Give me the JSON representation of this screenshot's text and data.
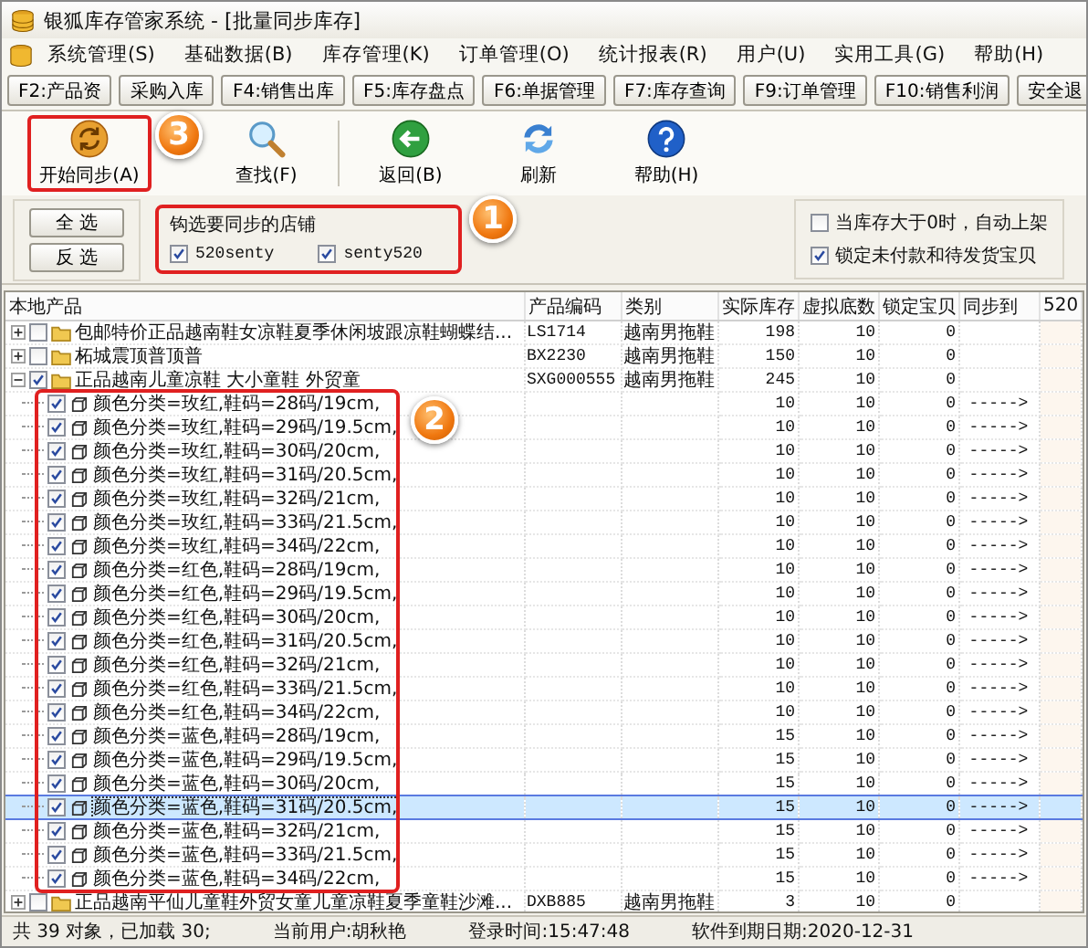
{
  "window": {
    "title": "银狐库存管家系统 - [批量同步库存]"
  },
  "menu": [
    "系统管理(S)",
    "基础数据(B)",
    "库存管理(K)",
    "订单管理(O)",
    "统计报表(R)",
    "用户(U)",
    "实用工具(G)",
    "帮助(H)"
  ],
  "function_keys": [
    "F2:产品资",
    "采购入库",
    "F4:销售出库",
    "F5:库存盘点",
    "F6:单据管理",
    "F7:库存查询",
    "F9:订单管理",
    "F10:销售利润",
    "安全退"
  ],
  "toolbar": [
    {
      "kind": "sync",
      "label": "开始同步(A)",
      "highlighted": true,
      "callout": "3"
    },
    {
      "kind": "search",
      "label": "查找(F)",
      "highlighted": false
    },
    {
      "kind": "separator"
    },
    {
      "kind": "back",
      "label": "返回(B)",
      "highlighted": false
    },
    {
      "kind": "refresh",
      "label": "刷新",
      "highlighted": false
    },
    {
      "kind": "help",
      "label": "帮助(H)",
      "highlighted": false
    }
  ],
  "selection_buttons": [
    "全 选",
    "反 选"
  ],
  "store_group": {
    "title": "钩选要同步的店铺",
    "highlighted": true,
    "callout": "1",
    "stores": [
      {
        "name": "520senty",
        "checked": true
      },
      {
        "name": "senty520",
        "checked": true
      }
    ]
  },
  "settings": [
    {
      "label": "当库存大于0时，自动上架",
      "checked": false
    },
    {
      "label": "锁定未付款和待发货宝贝",
      "checked": true
    }
  ],
  "table": {
    "columns": [
      "本地产品",
      "产品编码",
      "类别",
      "实际库存",
      "虚拟底数",
      "锁定宝贝",
      "同步到",
      "520"
    ],
    "rows": [
      {
        "label": "包邮特价正品越南鞋女凉鞋夏季休闲坡跟凉鞋蝴蝶结...",
        "code": "LS1714",
        "category": "越南男拖鞋",
        "stock": "198",
        "virtual": "10",
        "locked": "0",
        "checked": false,
        "expanded": false,
        "selected": false
      },
      {
        "label": "柘城震顶普顶普",
        "code": "BX2230",
        "category": "越南男拖鞋",
        "stock": "150",
        "virtual": "10",
        "locked": "0",
        "checked": false,
        "expanded": false,
        "selected": false
      },
      {
        "label": "正品越南儿童凉鞋 大小童鞋 外贸童",
        "code": "SXG000555",
        "category": "越南男拖鞋",
        "stock": "245",
        "virtual": "10",
        "locked": "0",
        "checked": true,
        "expanded": true,
        "selected": false,
        "callout": "2",
        "children_framed": true,
        "children": [
          {
            "label": "颜色分类=玫红,鞋码=28码/19cm,",
            "stock": "10",
            "virtual": "10",
            "locked": "0",
            "sync": "----->",
            "checked": true,
            "selected": false
          },
          {
            "label": "颜色分类=玫红,鞋码=29码/19.5cm,",
            "stock": "10",
            "virtual": "10",
            "locked": "0",
            "sync": "----->",
            "checked": true,
            "selected": false
          },
          {
            "label": "颜色分类=玫红,鞋码=30码/20cm,",
            "stock": "10",
            "virtual": "10",
            "locked": "0",
            "sync": "----->",
            "checked": true,
            "selected": false
          },
          {
            "label": "颜色分类=玫红,鞋码=31码/20.5cm,",
            "stock": "10",
            "virtual": "10",
            "locked": "0",
            "sync": "----->",
            "checked": true,
            "selected": false
          },
          {
            "label": "颜色分类=玫红,鞋码=32码/21cm,",
            "stock": "10",
            "virtual": "10",
            "locked": "0",
            "sync": "----->",
            "checked": true,
            "selected": false
          },
          {
            "label": "颜色分类=玫红,鞋码=33码/21.5cm,",
            "stock": "10",
            "virtual": "10",
            "locked": "0",
            "sync": "----->",
            "checked": true,
            "selected": false
          },
          {
            "label": "颜色分类=玫红,鞋码=34码/22cm,",
            "stock": "10",
            "virtual": "10",
            "locked": "0",
            "sync": "----->",
            "checked": true,
            "selected": false
          },
          {
            "label": "颜色分类=红色,鞋码=28码/19cm,",
            "stock": "10",
            "virtual": "10",
            "locked": "0",
            "sync": "----->",
            "checked": true,
            "selected": false
          },
          {
            "label": "颜色分类=红色,鞋码=29码/19.5cm,",
            "stock": "10",
            "virtual": "10",
            "locked": "0",
            "sync": "----->",
            "checked": true,
            "selected": false
          },
          {
            "label": "颜色分类=红色,鞋码=30码/20cm,",
            "stock": "10",
            "virtual": "10",
            "locked": "0",
            "sync": "----->",
            "checked": true,
            "selected": false
          },
          {
            "label": "颜色分类=红色,鞋码=31码/20.5cm,",
            "stock": "10",
            "virtual": "10",
            "locked": "0",
            "sync": "----->",
            "checked": true,
            "selected": false
          },
          {
            "label": "颜色分类=红色,鞋码=32码/21cm,",
            "stock": "10",
            "virtual": "10",
            "locked": "0",
            "sync": "----->",
            "checked": true,
            "selected": false
          },
          {
            "label": "颜色分类=红色,鞋码=33码/21.5cm,",
            "stock": "10",
            "virtual": "10",
            "locked": "0",
            "sync": "----->",
            "checked": true,
            "selected": false
          },
          {
            "label": "颜色分类=红色,鞋码=34码/22cm,",
            "stock": "10",
            "virtual": "10",
            "locked": "0",
            "sync": "----->",
            "checked": true,
            "selected": false
          },
          {
            "label": "颜色分类=蓝色,鞋码=28码/19cm,",
            "stock": "15",
            "virtual": "10",
            "locked": "0",
            "sync": "----->",
            "checked": true,
            "selected": false
          },
          {
            "label": "颜色分类=蓝色,鞋码=29码/19.5cm,",
            "stock": "15",
            "virtual": "10",
            "locked": "0",
            "sync": "----->",
            "checked": true,
            "selected": false
          },
          {
            "label": "颜色分类=蓝色,鞋码=30码/20cm,",
            "stock": "15",
            "virtual": "10",
            "locked": "0",
            "sync": "----->",
            "checked": true,
            "selected": false
          },
          {
            "label": "颜色分类=蓝色,鞋码=31码/20.5cm,",
            "stock": "15",
            "virtual": "10",
            "locked": "0",
            "sync": "----->",
            "checked": true,
            "selected": true
          },
          {
            "label": "颜色分类=蓝色,鞋码=32码/21cm,",
            "stock": "15",
            "virtual": "10",
            "locked": "0",
            "sync": "----->",
            "checked": true,
            "selected": false
          },
          {
            "label": "颜色分类=蓝色,鞋码=33码/21.5cm,",
            "stock": "15",
            "virtual": "10",
            "locked": "0",
            "sync": "----->",
            "checked": true,
            "selected": false
          },
          {
            "label": "颜色分类=蓝色,鞋码=34码/22cm,",
            "stock": "15",
            "virtual": "10",
            "locked": "0",
            "sync": "----->",
            "checked": true,
            "selected": false
          }
        ]
      },
      {
        "label": "正品越南平仙儿童鞋外贸女童儿童凉鞋夏季童鞋沙滩...",
        "code": "DXB885",
        "category": "越南男拖鞋",
        "stock": "3",
        "virtual": "10",
        "locked": "0",
        "checked": false,
        "expanded": false,
        "selected": false
      }
    ]
  },
  "status_bar": [
    "共 39 对象，已加载 30;",
    "当前用户:胡秋艳",
    "登录时间:15:47:48",
    "软件到期日期:2020-12-31"
  ]
}
